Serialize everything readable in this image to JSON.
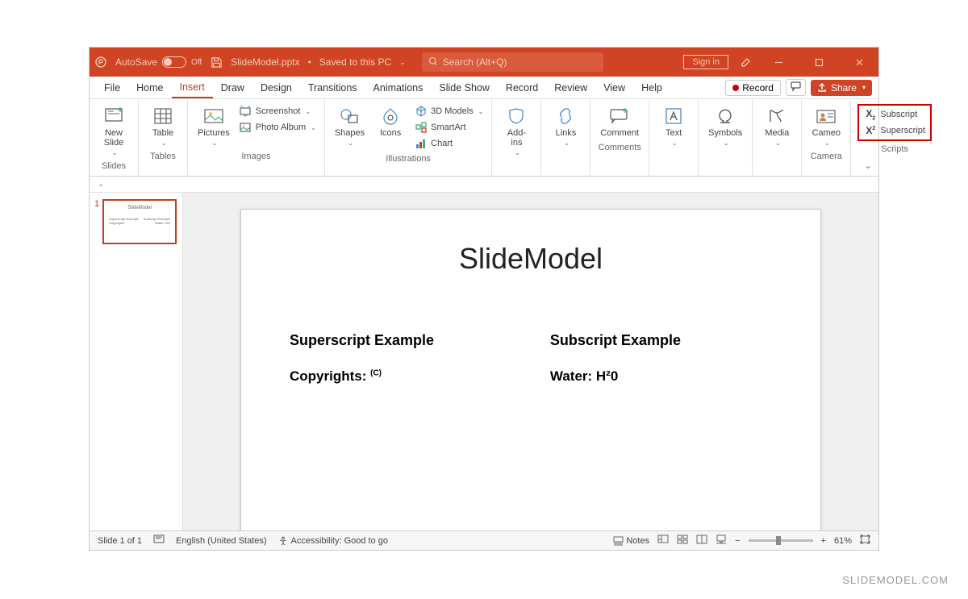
{
  "titlebar": {
    "autosave_label": "AutoSave",
    "autosave_state": "Off",
    "filename": "SlideModel.pptx",
    "saved_status": "Saved to this PC",
    "search_placeholder": "Search (Alt+Q)",
    "signin": "Sign in"
  },
  "menu": {
    "items": [
      "File",
      "Home",
      "Insert",
      "Draw",
      "Design",
      "Transitions",
      "Animations",
      "Slide Show",
      "Record",
      "Review",
      "View",
      "Help"
    ],
    "active": "Insert",
    "record": "Record",
    "share": "Share"
  },
  "ribbon": {
    "slides": {
      "label": "Slides",
      "new_slide": "New\nSlide"
    },
    "tables": {
      "label": "Tables",
      "table": "Table"
    },
    "images": {
      "label": "Images",
      "pictures": "Pictures",
      "screenshot": "Screenshot",
      "photo_album": "Photo Album"
    },
    "illustrations": {
      "label": "Illustrations",
      "shapes": "Shapes",
      "icons": "Icons",
      "models": "3D Models",
      "smartart": "SmartArt",
      "chart": "Chart"
    },
    "addins": {
      "label": "",
      "addins": "Add-\nins"
    },
    "links": {
      "label": "",
      "links": "Links"
    },
    "comments": {
      "label": "Comments",
      "comment": "Comment"
    },
    "text": {
      "label": "",
      "text": "Text"
    },
    "symbols": {
      "label": "",
      "symbols": "Symbols"
    },
    "media": {
      "label": "",
      "media": "Media"
    },
    "camera": {
      "label": "Camera",
      "cameo": "Cameo"
    },
    "scripts": {
      "label": "Scripts",
      "subscript": "Subscript",
      "superscript": "Superscript"
    }
  },
  "thumb": {
    "number": "1"
  },
  "slide": {
    "title": "SlideModel",
    "left_heading": "Superscript Example",
    "left_body_pre": "Copyrights: ",
    "left_body_sup": "(C)",
    "right_heading": "Subscript Example",
    "right_body": "Water: H²0"
  },
  "status": {
    "slide_of": "Slide 1 of 1",
    "lang": "English (United States)",
    "accessibility": "Accessibility: Good to go",
    "notes": "Notes",
    "zoom": "61%"
  },
  "watermark": "SLIDEMODEL.COM"
}
